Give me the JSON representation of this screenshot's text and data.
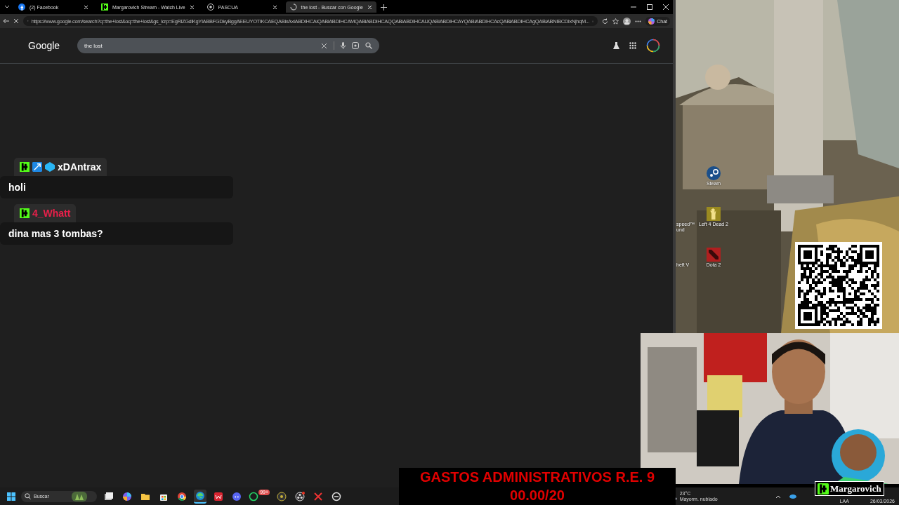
{
  "browser": {
    "tabs": [
      {
        "kind": "facebook",
        "title": "(2) Facebook",
        "selected": false
      },
      {
        "kind": "kick",
        "title": "Margarovich Stream - Watch Live",
        "selected": false
      },
      {
        "kind": "chrome",
        "title": "PASCUA",
        "selected": false
      },
      {
        "kind": "loading",
        "title": "the lost - Buscar con Google",
        "selected": true
      }
    ],
    "url": "https://www.google.com/search?q=the+lost&oq=the+lost&gs_lcrp=EgRlZGdlKgYIABBFGDkyBggAEEUYOTIKCAEQABixAxiABDIHCAIQABiABDIHCAMQABiABDIHCAQQABiABDIHCAUQABiABDIHCAYQABiABDIHCAcQABiABDIHCAgQABiABNIBCDIxNjhqM...",
    "chat_button": "Chat",
    "page": {
      "logo": "Google",
      "search": {
        "value": "the lost"
      }
    }
  },
  "chat": [
    {
      "badges": [
        {
          "kind": "kick"
        },
        {
          "kind": "arrow"
        },
        {
          "kind": "gem"
        }
      ],
      "user": "xDAntrax",
      "color": "#ffffff",
      "message": "holi"
    },
    {
      "badges": [
        {
          "kind": "kick"
        }
      ],
      "user": "4_Whatt",
      "color": "#e8204a",
      "message": "dina mas 3 tombas?"
    }
  ],
  "desktop": {
    "icons": [
      {
        "kind": "steam",
        "label": "Steam"
      },
      {
        "kind": "zombie",
        "label": "Left 4 Dead 2"
      },
      {
        "kind": "dota",
        "label": "Dota 2"
      }
    ],
    "edge_labels": [
      "speed™ und",
      "heft V"
    ]
  },
  "banner": {
    "line_1": "GASTOS ADMINISTRATIVOS R.E. 9",
    "line_2": "00.00/20"
  },
  "stream_logo": "Margarovich",
  "taskbar": {
    "search_placeholder": "Buscar",
    "apps": [
      {
        "kind": "taskview",
        "selected": false
      },
      {
        "kind": "copilot",
        "selected": false
      },
      {
        "kind": "folder",
        "selected": false
      },
      {
        "kind": "store",
        "selected": false
      },
      {
        "kind": "chrome",
        "selected": false
      },
      {
        "kind": "edge",
        "selected": true
      },
      {
        "kind": "wps",
        "selected": false
      },
      {
        "kind": "discord",
        "selected": false
      },
      {
        "kind": "whatsapp",
        "selected": false,
        "badge": "99+"
      },
      {
        "kind": "disc",
        "selected": false
      },
      {
        "kind": "obs",
        "selected": false
      },
      {
        "kind": "capcut",
        "selected": false
      },
      {
        "kind": "sync",
        "selected": false
      }
    ],
    "weather": {
      "temp": "23°C",
      "condition": "Mayorm. nublado"
    },
    "language": "LAA",
    "date": "26/03/2026"
  }
}
